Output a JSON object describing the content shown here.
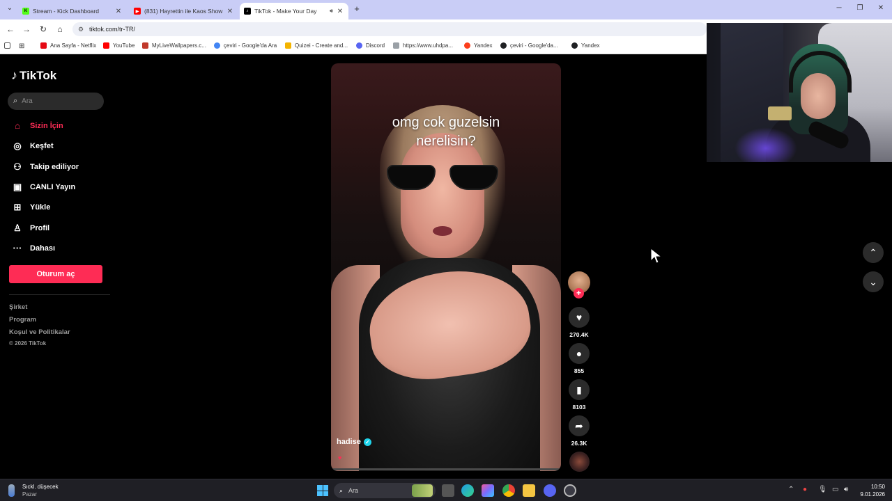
{
  "browser": {
    "tabs": [
      {
        "title": "Stream - Kick Dashboard",
        "icon": "kick-icon",
        "color": "#53fc18",
        "active": false
      },
      {
        "title": "(831) Hayrettin ile Kaos Show -",
        "icon": "youtube-icon",
        "color": "#ff0000",
        "active": false
      },
      {
        "title": "TikTok - Make Your Day",
        "icon": "tiktok-icon",
        "color": "#000000",
        "active": true
      }
    ],
    "url": "tiktok.com/tr-TR/",
    "bookmarks": [
      {
        "label": "Ana Sayfa - Netflix",
        "color": "#e50914"
      },
      {
        "label": "YouTube",
        "color": "#ff0000"
      },
      {
        "label": "MyLiveWallpapers.c...",
        "color": "#c0392b"
      },
      {
        "label": "çeviri - Google'da Ara",
        "color": "#4285f4"
      },
      {
        "label": "Quizei - Create and...",
        "color": "#f4b400"
      },
      {
        "label": "Discord",
        "color": "#5865f2"
      },
      {
        "label": "https://www.uhdpa...",
        "color": "#9aa0a6"
      },
      {
        "label": "Yandex",
        "color": "#fc3f1d"
      },
      {
        "label": "çeviri - Google'da...",
        "color": "#202124"
      },
      {
        "label": "Yandex",
        "color": "#202124"
      }
    ]
  },
  "tiktok": {
    "brand": "TikTok",
    "search_placeholder": "Ara",
    "nav": [
      {
        "label": "Sizin İçin",
        "icon": "home-icon",
        "glyph": "⌂",
        "active": true
      },
      {
        "label": "Keşfet",
        "icon": "compass-icon",
        "glyph": "◎",
        "active": false
      },
      {
        "label": "Takip ediliyor",
        "icon": "following-icon",
        "glyph": "⚇",
        "active": false
      },
      {
        "label": "CANLI Yayın",
        "icon": "live-icon",
        "glyph": "▣",
        "active": false
      },
      {
        "label": "Yükle",
        "icon": "upload-icon",
        "glyph": "⊞",
        "active": false
      },
      {
        "label": "Profil",
        "icon": "profile-icon",
        "glyph": "♙",
        "active": false
      },
      {
        "label": "Dahası",
        "icon": "more-icon",
        "glyph": "···",
        "active": false
      }
    ],
    "login_label": "Oturum aç",
    "footer": [
      "Şirket",
      "Program",
      "Koşul ve Politikalar"
    ],
    "copyright": "© 2026 TikTok",
    "video": {
      "caption_line1": "omg cok guzelsin",
      "caption_line2": "nerelisin?",
      "author": "hadise",
      "music_icon": "♥"
    },
    "actions": {
      "likes": "270.4K",
      "comments": "855",
      "saves": "8103",
      "shares": "26.3K"
    }
  },
  "taskbar": {
    "weather_line1": "Sıckl. düşecek",
    "weather_line2": "Pazar",
    "search_placeholder": "Ara",
    "time": "10:50",
    "date": "9.01.2026"
  },
  "colors": {
    "accent": "#fe2c55",
    "verified": "#20d5ec"
  }
}
